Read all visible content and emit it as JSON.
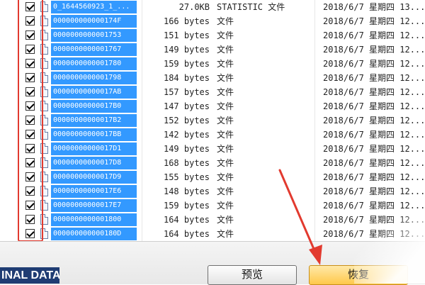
{
  "files": [
    {
      "name": "0_1644560923_1_...",
      "size": "27.0KB",
      "type": "STATISTIC 文件",
      "date": "2018/6/7 星期四 13..."
    },
    {
      "name": "000000000000174F",
      "size": "166 bytes",
      "type": "文件",
      "date": "2018/6/7 星期四 12..."
    },
    {
      "name": "0000000000001753",
      "size": "151 bytes",
      "type": "文件",
      "date": "2018/6/7 星期四 12..."
    },
    {
      "name": "0000000000001767",
      "size": "149 bytes",
      "type": "文件",
      "date": "2018/6/7 星期四 12..."
    },
    {
      "name": "0000000000001780",
      "size": "159 bytes",
      "type": "文件",
      "date": "2018/6/7 星期四 12..."
    },
    {
      "name": "0000000000001798",
      "size": "184 bytes",
      "type": "文件",
      "date": "2018/6/7 星期四 12..."
    },
    {
      "name": "00000000000017AB",
      "size": "157 bytes",
      "type": "文件",
      "date": "2018/6/7 星期四 12..."
    },
    {
      "name": "00000000000017B0",
      "size": "147 bytes",
      "type": "文件",
      "date": "2018/6/7 星期四 12..."
    },
    {
      "name": "00000000000017B2",
      "size": "152 bytes",
      "type": "文件",
      "date": "2018/6/7 星期四 12..."
    },
    {
      "name": "00000000000017BB",
      "size": "142 bytes",
      "type": "文件",
      "date": "2018/6/7 星期四 12..."
    },
    {
      "name": "00000000000017D1",
      "size": "149 bytes",
      "type": "文件",
      "date": "2018/6/7 星期四 12..."
    },
    {
      "name": "00000000000017D8",
      "size": "168 bytes",
      "type": "文件",
      "date": "2018/6/7 星期四 12..."
    },
    {
      "name": "00000000000017D9",
      "size": "155 bytes",
      "type": "文件",
      "date": "2018/6/7 星期四 12..."
    },
    {
      "name": "00000000000017E6",
      "size": "148 bytes",
      "type": "文件",
      "date": "2018/6/7 星期四 12..."
    },
    {
      "name": "00000000000017E7",
      "size": "159 bytes",
      "type": "文件",
      "date": "2018/6/7 星期四 12..."
    },
    {
      "name": "0000000000001800",
      "size": "164 bytes",
      "type": "文件",
      "date": "2018/6/7 星期四 12..."
    },
    {
      "name": "000000000000180D",
      "size": "164 bytes",
      "type": "文件",
      "date": "2018/6/7 星期四 12..."
    }
  ],
  "logo_text": "INAL DATA",
  "buttons": {
    "preview": "预览",
    "recover": "恢复"
  },
  "colors": {
    "selection": "#3399ff",
    "annotation": "#e23a2f",
    "logo_bg": "#1f3c73",
    "recover_button": "#ffc84a"
  }
}
